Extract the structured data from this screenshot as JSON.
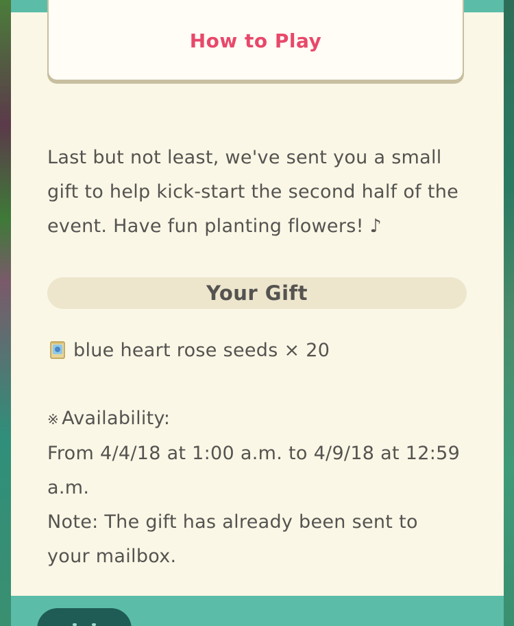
{
  "how_to_play": {
    "label": "How to Play"
  },
  "intro": {
    "text": "Last but not least, we've sent you a small gift to help kick-start the second half of the event. Have fun planting flowers! ♪"
  },
  "gift": {
    "header": "Your Gift",
    "item_icon": "seed-packet-icon",
    "item_text": "blue heart rose seeds × 20"
  },
  "availability": {
    "mark": "※",
    "label": "Availability:",
    "dates": "From 4/4/18 at 1:00 a.m. to 4/9/18 at 12:59 a.m.",
    "note": "Note: The gift has already been sent to your mailbox."
  },
  "colors": {
    "accent": "#5bbda8",
    "button_text": "#e8486a",
    "panel_bg": "#faf7e6",
    "text": "#555350"
  }
}
